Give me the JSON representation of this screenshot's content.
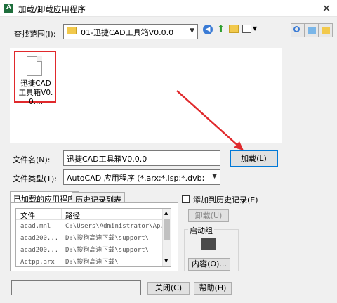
{
  "window": {
    "title": "加载/卸载应用程序",
    "close_glyph": "✕"
  },
  "lookin": {
    "label": "查找范围(I):",
    "value": "01-迅捷CAD工具箱V0.0.0"
  },
  "files": [
    {
      "name": "迅捷CAD工具箱V0.0...."
    }
  ],
  "filename": {
    "label": "文件名(N):",
    "value": "迅捷CAD工具箱V0.0.0"
  },
  "filetype": {
    "label": "文件类型(T):",
    "value": "AutoCAD 应用程序 (*.arx;*.lsp;*.dvb;*.dbx;*.vb"
  },
  "load_button": "加载(L)",
  "tabs": [
    {
      "label": "已加载的应用程序"
    },
    {
      "label": "历史记录列表"
    }
  ],
  "loaded_table": {
    "headers": [
      "文件",
      "路径"
    ],
    "rows": [
      {
        "file": "acad.mnl",
        "path": "C:\\Users\\Administrator\\Ap..."
      },
      {
        "file": "acad200...",
        "path": "D:\\搜狗高速下载\\support\\"
      },
      {
        "file": "acad200...",
        "path": "D:\\搜狗高速下载\\support\\"
      },
      {
        "file": "Actpp.arx",
        "path": "D:\\搜狗高速下载\\"
      }
    ]
  },
  "add_history": {
    "label": "添加到历史记录(E)"
  },
  "unload_button": "卸载(U)",
  "startup_group": {
    "label": "启动组",
    "contents_button": "内容(O)..."
  },
  "close_button": "关闭(C)",
  "help_button": "帮助(H)",
  "colors": {
    "highlight": "#e0292c",
    "accent": "#0078d7"
  }
}
